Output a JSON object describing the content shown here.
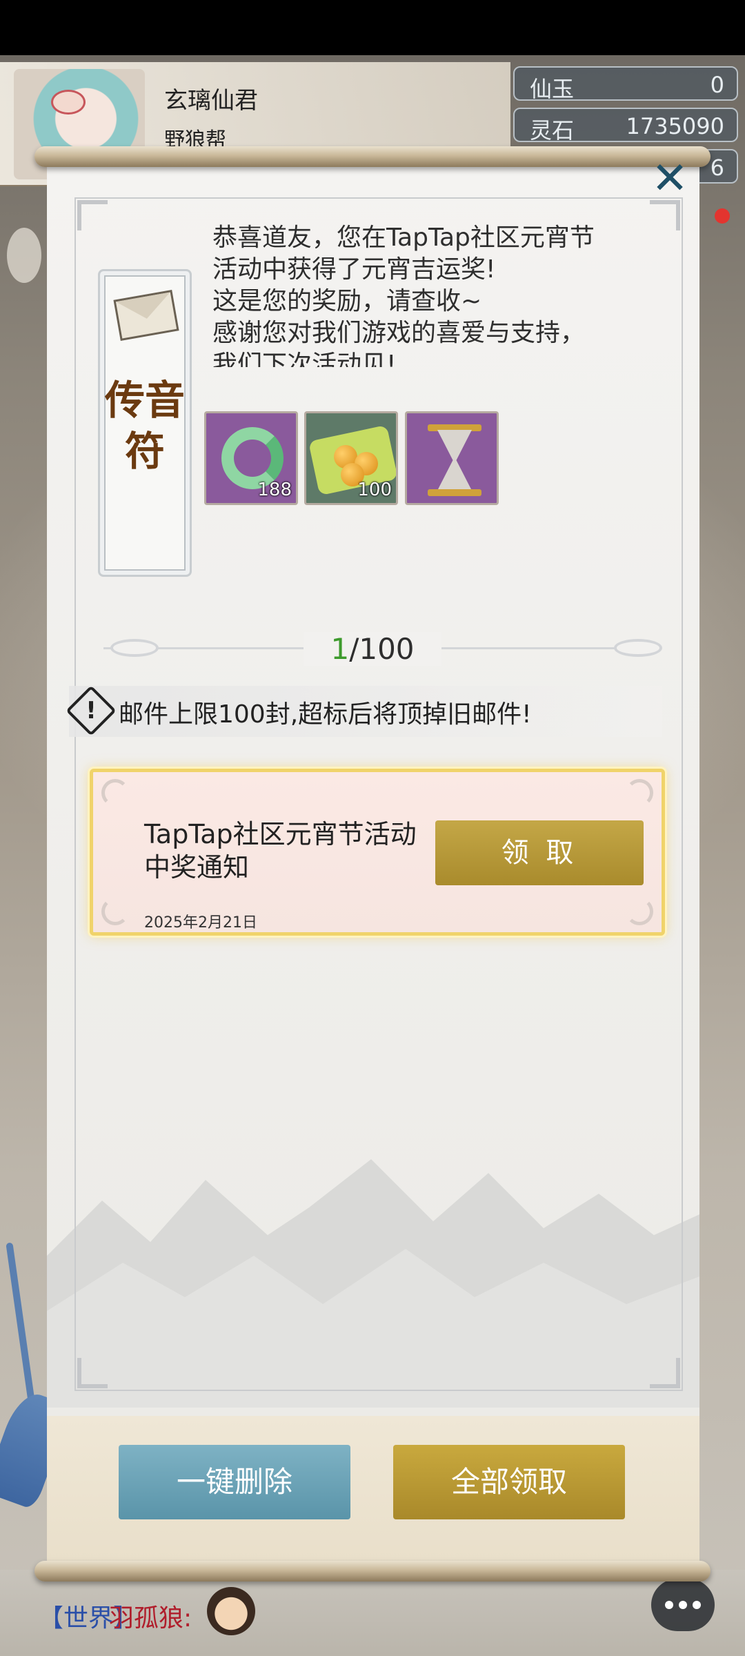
{
  "player": {
    "name": "玄璃仙君",
    "guild": "野狼帮"
  },
  "currencies": [
    {
      "label": "仙玉",
      "value": "0"
    },
    {
      "label": "灵石",
      "value": "1735090"
    },
    {
      "label": "",
      "value": "6"
    }
  ],
  "mail": {
    "talisman_label": "传音符",
    "body_lines": [
      "恭喜道友，您在TapTap社区元宵节",
      "活动中获得了元宵吉运奖!",
      "这是您的奖励，请查收~",
      "感谢您对我们游戏的喜爱与支持，",
      "我们下次活动见!"
    ],
    "rewards": [
      {
        "icon": "jade-pendant-icon",
        "qty": "188"
      },
      {
        "icon": "golden-orbs-icon",
        "qty": "100"
      },
      {
        "icon": "hourglass-icon",
        "qty": ""
      }
    ],
    "page_current": "1",
    "page_total": "/100",
    "limit_notice": "邮件上限100封,超标后将顶掉旧邮件!"
  },
  "mail_list": [
    {
      "title": "TapTap社区元宵节活动中奖通知",
      "date": "2025年2月21日",
      "claim_label": "领 取"
    }
  ],
  "actions": {
    "delete_all": "一键删除",
    "claim_all": "全部领取"
  },
  "chat": {
    "channel": "【世界】",
    "user": "羽孤狼:"
  },
  "colors": {
    "accent_gold": "#b0922f",
    "accent_teal": "#6aa3b6",
    "page_current": "#3d9a2c",
    "close_icon": "#1f4f66"
  }
}
